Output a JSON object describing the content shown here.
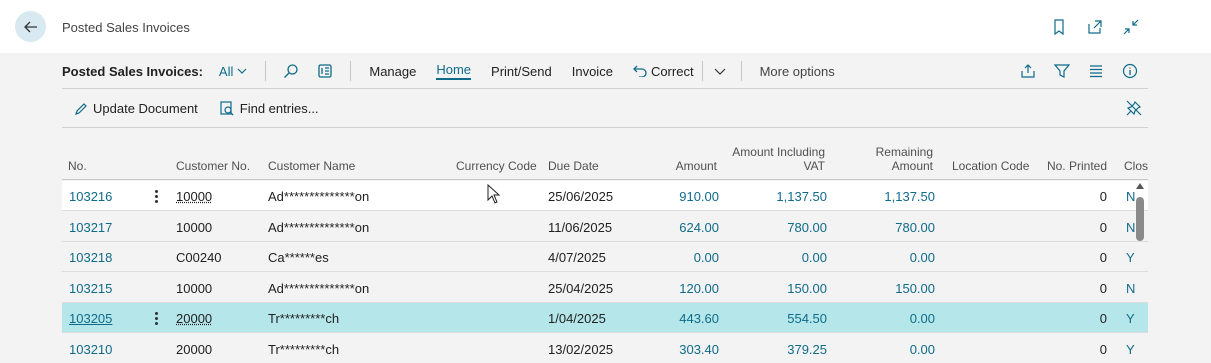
{
  "header": {
    "caption": "Posted Sales Invoices"
  },
  "actionbar": {
    "title": "Posted Sales Invoices:",
    "view": "All",
    "items": [
      "Manage",
      "Home",
      "Print/Send",
      "Invoice",
      "Correct",
      "More options"
    ],
    "active_item": "Home"
  },
  "subbar": {
    "update_document": "Update Document",
    "find_entries": "Find entries..."
  },
  "table": {
    "columns": [
      "No.",
      "Customer No.",
      "Customer Name",
      "Currency Code",
      "Due Date",
      "Amount",
      "Amount Including VAT",
      "Remaining Amount",
      "Location Code",
      "No. Printed",
      "Close"
    ],
    "col_amount_incl_1": "Amount Including",
    "col_amount_incl_2": "VAT",
    "col_remaining_1": "Remaining",
    "col_remaining_2": "Amount",
    "rows": [
      {
        "no": "103216",
        "customer_no": "10000",
        "customer_name": "Ad**************on",
        "currency": "",
        "due_date": "25/06/2025",
        "amount": "910.00",
        "amount_incl_vat": "1,137.50",
        "remaining": "1,137.50",
        "location": "",
        "printed": "0",
        "closed": "N"
      },
      {
        "no": "103217",
        "customer_no": "10000",
        "customer_name": "Ad**************on",
        "currency": "",
        "due_date": "11/06/2025",
        "amount": "624.00",
        "amount_incl_vat": "780.00",
        "remaining": "780.00",
        "location": "",
        "printed": "0",
        "closed": "N"
      },
      {
        "no": "103218",
        "customer_no": "C00240",
        "customer_name": "Ca******es",
        "currency": "",
        "due_date": "4/07/2025",
        "amount": "0.00",
        "amount_incl_vat": "0.00",
        "remaining": "0.00",
        "location": "",
        "printed": "0",
        "closed": "Y"
      },
      {
        "no": "103215",
        "customer_no": "10000",
        "customer_name": "Ad**************on",
        "currency": "",
        "due_date": "25/04/2025",
        "amount": "120.00",
        "amount_incl_vat": "150.00",
        "remaining": "150.00",
        "location": "",
        "printed": "0",
        "closed": "N"
      },
      {
        "no": "103205",
        "customer_no": "20000",
        "customer_name": "Tr*********ch",
        "currency": "",
        "due_date": "1/04/2025",
        "amount": "443.60",
        "amount_incl_vat": "554.50",
        "remaining": "0.00",
        "location": "",
        "printed": "0",
        "closed": "Y"
      },
      {
        "no": "103210",
        "customer_no": "20000",
        "customer_name": "Tr*********ch",
        "currency": "",
        "due_date": "13/02/2025",
        "amount": "303.40",
        "amount_incl_vat": "379.25",
        "remaining": "0.00",
        "location": "",
        "printed": "0",
        "closed": "Y"
      }
    ]
  },
  "colors": {
    "link": "#0f6b8a",
    "selected_row": "#b5e7ea",
    "back_button_bg": "#d9e9f2"
  },
  "icons": [
    "back-arrow-icon",
    "bookmark-icon",
    "open-new-window-icon",
    "collapse-icon",
    "chevron-down-icon",
    "search-icon",
    "edit-list-icon",
    "undo-arrow-icon",
    "share-icon",
    "filter-icon",
    "list-view-icon",
    "info-icon",
    "pencil-icon",
    "find-entries-icon",
    "unpin-icon",
    "mouse-cursor-icon"
  ]
}
